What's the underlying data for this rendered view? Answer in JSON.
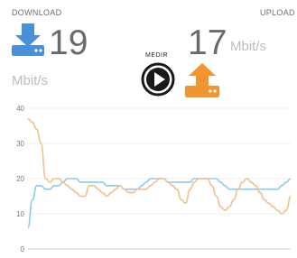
{
  "header": {
    "download_label": "DOWNLOAD",
    "upload_label": "UPLOAD",
    "download_value": "19",
    "upload_value": "17",
    "unit": "Mbit/s",
    "medir_label": "MEDIR"
  },
  "icons": {
    "download": "download-icon",
    "upload": "upload-icon",
    "play": "play-icon"
  },
  "colors": {
    "download": "#4a90d9",
    "upload": "#f0952f",
    "download_line": "#8ecbe8",
    "upload_line": "#f2c08b"
  },
  "chart_data": {
    "type": "line",
    "x": [
      0,
      1,
      2,
      3,
      4,
      5,
      6,
      7,
      8,
      9,
      10,
      11,
      12,
      13,
      14,
      15,
      16,
      17,
      18,
      19,
      20,
      21,
      22,
      23,
      24,
      25,
      26,
      27,
      28,
      29,
      30,
      31,
      32,
      33,
      34,
      35,
      36,
      37,
      38,
      39,
      40,
      41,
      42,
      43,
      44,
      45,
      46,
      47,
      48,
      49,
      50,
      51,
      52,
      53,
      54,
      55,
      56,
      57,
      58,
      59,
      60
    ],
    "ylim": [
      0,
      40
    ],
    "yticks": [
      0,
      10,
      20,
      30,
      40
    ],
    "grid": true,
    "series": [
      {
        "values": [
          6,
          14,
          18,
          18,
          17,
          17,
          18,
          18,
          19,
          20,
          20,
          20,
          19,
          19,
          19,
          19,
          19,
          19,
          18,
          18,
          18,
          18,
          17,
          17,
          17,
          17,
          18,
          19,
          20,
          20,
          20,
          20,
          19,
          19,
          19,
          19,
          19,
          19,
          20,
          20,
          20,
          20,
          20,
          20,
          19,
          18,
          17,
          17,
          17,
          17,
          17,
          17,
          17,
          17,
          17,
          17,
          17,
          17,
          18,
          19,
          20
        ]
      },
      {
        "values": [
          37,
          36,
          34,
          30,
          20,
          19,
          20,
          20,
          19,
          18,
          17,
          16,
          15,
          15,
          18,
          18,
          17,
          16,
          15,
          16,
          17,
          18,
          17,
          16,
          16,
          17,
          17,
          17,
          18,
          19,
          20,
          20,
          19,
          18,
          17,
          14,
          13,
          17,
          19,
          20,
          20,
          20,
          18,
          15,
          12,
          11,
          12,
          14,
          17,
          19,
          20,
          19,
          18,
          16,
          14,
          13,
          12,
          11,
          10,
          11,
          15
        ]
      }
    ]
  }
}
